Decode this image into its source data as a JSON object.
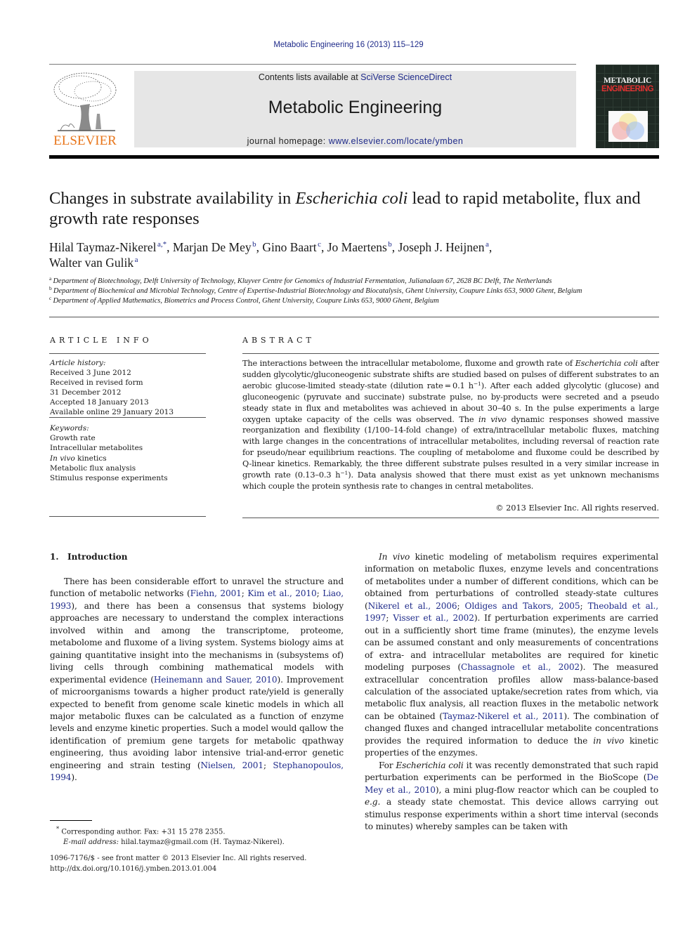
{
  "header": {
    "journal_ref": "Metabolic Engineering 16 (2013) 115–129",
    "publisher_logo_text": "ELSEVIER",
    "contents_prefix": "Contents lists available at ",
    "contents_link": "SciVerse ScienceDirect",
    "journal_name": "Metabolic Engineering",
    "homepage_prefix": "journal homepage: ",
    "homepage_link": "www.elsevier.com/locate/ymben",
    "cover_title_1": "METABOLIC",
    "cover_title_2": "ENGINEERING"
  },
  "article": {
    "title_part1": "Changes in substrate availability in ",
    "title_italic": "Escherichia coli",
    "title_part2": " lead to rapid metabolite, flux and growth rate responses",
    "authors": [
      {
        "name": "Hilal Taymaz-Nikerel",
        "sup": "a,",
        "mark": "*",
        "sep": ", "
      },
      {
        "name": "Marjan De Mey",
        "sup": "b",
        "mark": "",
        "sep": ", "
      },
      {
        "name": "Gino Baart",
        "sup": "c",
        "mark": "",
        "sep": ", "
      },
      {
        "name": "Jo Maertens",
        "sup": "b",
        "mark": "",
        "sep": ", "
      },
      {
        "name": "Joseph J. Heijnen",
        "sup": "a",
        "mark": "",
        "sep": ","
      },
      {
        "name": "Walter van Gulik",
        "sup": "a",
        "mark": "",
        "sep": ""
      }
    ],
    "affiliations": [
      {
        "key": "a",
        "text": "Department of Biotechnology, Delft University of Technology, Kluyver Centre for Genomics of Industrial Fermentation, Julianalaan 67, 2628 BC Delft, The Netherlands"
      },
      {
        "key": "b",
        "text": "Department of Biochemical and Microbial Technology, Centre of Expertise-Industrial Biotechnology and Biocatalysis, Ghent University, Coupure Links 653, 9000 Ghent, Belgium"
      },
      {
        "key": "c",
        "text": "Department of Applied Mathematics, Biometrics and Process Control, Ghent University, Coupure Links 653, 9000 Ghent, Belgium"
      }
    ]
  },
  "article_info": {
    "heading": "ARTICLE INFO",
    "history_label": "Article history:",
    "history": [
      "Received 3 June 2012",
      "Received in revised form",
      "31 December 2012",
      "Accepted 18 January 2013",
      "Available online 29 January 2013"
    ],
    "keywords_label": "Keywords:",
    "keywords": [
      "Growth rate",
      "Intracellular metabolites",
      "In vivo kinetics",
      "Metabolic flux analysis",
      "Stimulus response experiments"
    ]
  },
  "abstract": {
    "heading": "ABSTRACT",
    "s1": "The interactions between the intracellular metabolome, fluxome and growth rate of ",
    "s1_italic": "Escherichia coli",
    "s2": " after sudden glycolytic/gluconeogenic substrate shifts are studied based on pulses of different substrates to an aerobic glucose-limited steady-state (dilution rate = 0.1 h",
    "sup1": "−1",
    "s3": "). After each added glycolytic (glucose) and gluconeogenic (pyruvate and succinate) substrate pulse, no by-products were secreted and a pseudo steady state in flux and metabolites was achieved in about 30–40 s. In the pulse experiments a large oxygen uptake capacity of the cells was observed. The ",
    "s3_italic": "in vivo",
    "s4": " dynamic responses showed massive reorganization and flexibility (1/100–14-fold change) of extra/intracellular metabolic fluxes, matching with large changes in the concentrations of intracellular metabolites, including reversal of reaction rate for pseudo/near equilibrium reactions. The coupling of metabolome and fluxome could be described by Q-linear kinetics. Remarkably, the three different substrate pulses resulted in a very similar increase in growth rate (0.13–0.3 h",
    "sup2": "−1",
    "s5": "). Data analysis showed that there must exist as yet unknown mechanisms which couple the protein synthesis rate to changes in central metabolites.",
    "copyright": "© 2013 Elsevier Inc. All rights reserved."
  },
  "body": {
    "section_heading": "1.   Introduction",
    "left_p1": [
      {
        "t": "There has been considerable effort to unravel the structure and function of metabolic networks ("
      },
      {
        "t": "Fiehn, 2001",
        "link": true
      },
      {
        "t": "; "
      },
      {
        "t": "Kim et al., 2010",
        "link": true
      },
      {
        "t": "; "
      },
      {
        "t": "Liao, 1993",
        "link": true
      },
      {
        "t": "), and there has been a consensus that systems biology approaches are necessary to understand the complex interactions involved within and among the transcriptome, proteome, metabolome and fluxome of a living system. Systems biology aims at gaining quantitative insight into the mechanisms in (subsystems of) living cells through combining mathematical models with experimental evidence ("
      },
      {
        "t": "Heinemann and Sauer, 2010",
        "link": true
      },
      {
        "t": "). Improvement of microorganisms towards a higher product rate/yield is generally expected to benefit from genome scale kinetic models in which all major metabolic fluxes can be calculated as a function of enzyme levels and enzyme kinetic properties. Such a model would qallow the identification of premium gene targets for metabolic qpathway engineering, thus avoiding labor intensive trial-and-error genetic engineering and strain testing ("
      },
      {
        "t": "Nielsen, 2001",
        "link": true
      },
      {
        "t": "; "
      },
      {
        "t": "Stephanopoulos, 1994",
        "link": true
      },
      {
        "t": ")."
      }
    ],
    "right_p1": [
      {
        "t": "In vivo",
        "italic": true
      },
      {
        "t": " kinetic modeling of metabolism requires experimental information on metabolic fluxes, enzyme levels and concentrations of metabolites under a number of different conditions, which can be obtained from perturbations of controlled steady-state cultures ("
      },
      {
        "t": "Nikerel et al., 2006",
        "link": true
      },
      {
        "t": "; "
      },
      {
        "t": "Oldiges and Takors, 2005",
        "link": true
      },
      {
        "t": "; "
      },
      {
        "t": "Theobald et al., 1997",
        "link": true
      },
      {
        "t": "; "
      },
      {
        "t": "Visser et al., 2002",
        "link": true
      },
      {
        "t": "). If perturbation experiments are carried out in a sufficiently short time frame (minutes), the enzyme levels can be assumed constant and only measurements of concentrations of extra- and intracellular metabolites are required for kinetic modeling purposes ("
      },
      {
        "t": "Chassagnole et al., 2002",
        "link": true
      },
      {
        "t": "). The measured extracellular concentration profiles allow mass-balance-based calculation of the associated uptake/secretion rates from which, via metabolic flux analysis, all reaction fluxes in the metabolic network can be obtained ("
      },
      {
        "t": "Taymaz-Nikerel et al., 2011",
        "link": true
      },
      {
        "t": "). The combination of changed fluxes and changed intracellular metabolite concentrations provides the required information to deduce the "
      },
      {
        "t": "in vivo",
        "italic": true
      },
      {
        "t": " kinetic properties of the enzymes."
      }
    ],
    "right_p2": [
      {
        "t": "For "
      },
      {
        "t": "Escherichia coli",
        "italic": true
      },
      {
        "t": " it was recently demonstrated that such rapid perturbation experiments can be performed in the BioScope ("
      },
      {
        "t": "De Mey et al., 2010",
        "link": true
      },
      {
        "t": "), a mini plug-flow reactor which can be coupled to "
      },
      {
        "t": "e.g.",
        "italic": true
      },
      {
        "t": " a steady state chemostat. This device allows carrying out stimulus response experiments within a short time interval (seconds to minutes) whereby samples can be taken with"
      }
    ]
  },
  "footnote": {
    "mark": "*",
    "corresponding": " Corresponding author. Fax: +31 15 278 2355.",
    "email_label": "E-mail address:",
    "email": " hilal.taymaz@gmail.com (H. Taymaz-Nikerel)."
  },
  "front_matter": {
    "issn_line": "1096-7176/$ - see front matter © 2013 Elsevier Inc. All rights reserved.",
    "doi": "http://dx.doi.org/10.1016/j.ymben.2013.01.004"
  },
  "colors": {
    "link": "#1f2b8a",
    "elsevier_orange": "#e8751a",
    "banner_bg": "#e6e6e6"
  }
}
